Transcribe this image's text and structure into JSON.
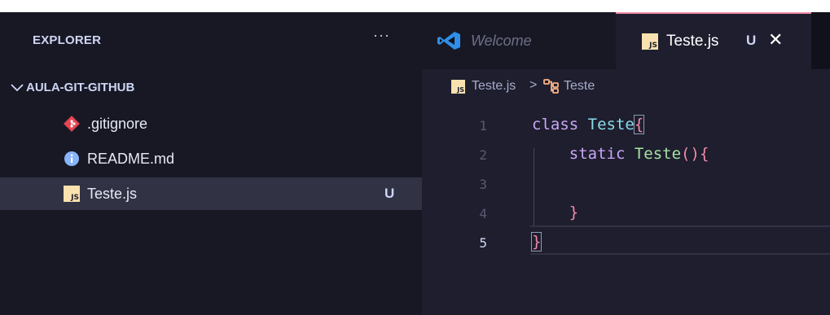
{
  "explorer": {
    "title": "EXPLORER",
    "more_label": "···",
    "folder": "AULA-GIT-GITHUB",
    "files": [
      {
        "name": ".gitignore",
        "icon": "git-icon",
        "status": ""
      },
      {
        "name": "README.md",
        "icon": "info-icon",
        "status": ""
      },
      {
        "name": "Teste.js",
        "icon": "js-icon",
        "status": "U"
      }
    ]
  },
  "tabs": [
    {
      "label": "Welcome",
      "icon": "vscode-icon"
    },
    {
      "label": "Teste.js",
      "icon": "js-icon",
      "status": "U",
      "close": "✕"
    }
  ],
  "breadcrumb": {
    "file": "Teste.js",
    "separator": ">",
    "symbol": "Teste"
  },
  "code": {
    "line_numbers": [
      "1",
      "2",
      "3",
      "4",
      "5"
    ],
    "lines": [
      [
        {
          "t": "class ",
          "c": "kw"
        },
        {
          "t": "Teste",
          "c": "cls"
        },
        {
          "t": "{",
          "c": "br"
        }
      ],
      [
        {
          "t": "    static ",
          "c": "kw"
        },
        {
          "t": "Teste",
          "c": "fn"
        },
        {
          "t": "()",
          "c": "br"
        },
        {
          "t": "{",
          "c": "br"
        }
      ],
      [],
      [
        {
          "t": "    }",
          "c": "br"
        }
      ],
      [
        {
          "t": "}",
          "c": "br"
        }
      ]
    ]
  },
  "colors": {
    "accent": "#f38ba8",
    "js": "#f9e2af",
    "git": "#e64553",
    "info": "#89b4fa"
  }
}
